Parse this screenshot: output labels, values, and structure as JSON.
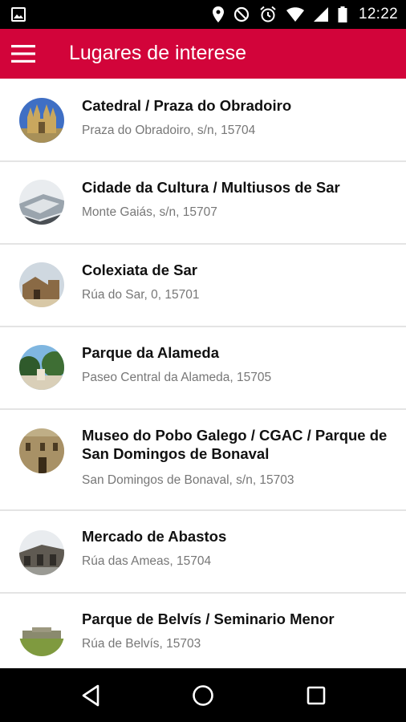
{
  "status_bar": {
    "time": "12:22",
    "icons": [
      "image-icon",
      "location-icon",
      "do-not-disturb-icon",
      "alarm-icon",
      "wifi-icon",
      "signal-icon",
      "battery-icon"
    ]
  },
  "app_bar": {
    "title": "Lugares de interese",
    "menu_icon": "hamburger-menu-icon",
    "color": "#d2043a"
  },
  "places": [
    {
      "title": "Catedral / Praza do Obradoiro",
      "address": "Praza do Obradoiro, s/n, 15704",
      "thumb": "cathedral"
    },
    {
      "title": "Cidade da Cultura / Multiusos de Sar",
      "address": "Monte Gaiás, s/n, 15707",
      "thumb": "modern-building"
    },
    {
      "title": "Colexiata de Sar",
      "address": "Rúa do Sar, 0, 15701",
      "thumb": "stone-church"
    },
    {
      "title": "Parque da Alameda",
      "address": "Paseo Central da Alameda, 15705",
      "thumb": "park-trees"
    },
    {
      "title": "Museo do Pobo Galego / CGAC / Parque de San Domingos de Bonaval",
      "address": "San Domingos de Bonaval, s/n, 15703",
      "thumb": "stone-museum"
    },
    {
      "title": "Mercado de Abastos",
      "address": "Rúa das Ameas, 15704",
      "thumb": "market-hall"
    },
    {
      "title": "Parque de Belvís / Seminario Menor",
      "address": "Rúa de Belvís, 15703",
      "thumb": "seminary-hill"
    }
  ],
  "nav_bar": {
    "buttons": [
      "back-icon",
      "home-icon",
      "recents-icon"
    ]
  }
}
